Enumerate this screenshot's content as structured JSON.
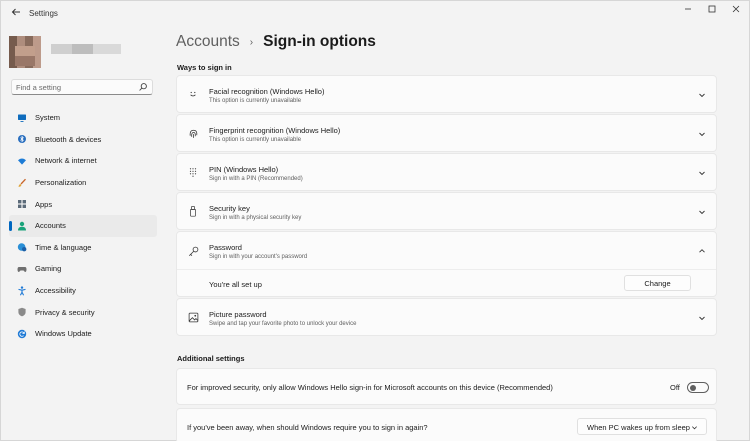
{
  "window": {
    "title": "Settings"
  },
  "search": {
    "placeholder": "Find a setting"
  },
  "sidebar": {
    "items": [
      {
        "label": "System",
        "icon": "monitor-icon",
        "color": "#0f6cbd",
        "active": false
      },
      {
        "label": "Bluetooth & devices",
        "icon": "bluetooth-icon",
        "color": "#2a6fbf",
        "active": false
      },
      {
        "label": "Network & internet",
        "icon": "wifi-icon",
        "color": "#1d7cd6",
        "active": false
      },
      {
        "label": "Personalization",
        "icon": "brush-icon",
        "color": "#c8642a",
        "active": false
      },
      {
        "label": "Apps",
        "icon": "apps-icon",
        "color": "#5c6b7a",
        "active": false
      },
      {
        "label": "Accounts",
        "icon": "person-icon",
        "color": "#1aa37a",
        "active": true
      },
      {
        "label": "Time & language",
        "icon": "globe-clock-icon",
        "color": "#2a8fd6",
        "active": false
      },
      {
        "label": "Gaming",
        "icon": "gamepad-icon",
        "color": "#707070",
        "active": false
      },
      {
        "label": "Accessibility",
        "icon": "accessibility-icon",
        "color": "#1f7ad6",
        "active": false
      },
      {
        "label": "Privacy & security",
        "icon": "shield-icon",
        "color": "#8a8a8a",
        "active": false
      },
      {
        "label": "Windows Update",
        "icon": "refresh-icon",
        "color": "#1f7ad6",
        "active": false
      }
    ]
  },
  "breadcrumb": {
    "parent": "Accounts",
    "separator": "›",
    "current": "Sign-in options"
  },
  "ways": {
    "heading": "Ways to sign in",
    "items": [
      {
        "title": "Facial recognition (Windows Hello)",
        "subtitle": "This option is currently unavailable",
        "icon": "smiley-face-icon"
      },
      {
        "title": "Fingerprint recognition (Windows Hello)",
        "subtitle": "This option is currently unavailable",
        "icon": "fingerprint-icon"
      },
      {
        "title": "PIN (Windows Hello)",
        "subtitle": "Sign in with a PIN (Recommended)",
        "icon": "keypad-icon"
      },
      {
        "title": "Security key",
        "subtitle": "Sign in with a physical security key",
        "icon": "usb-key-icon"
      },
      {
        "title": "Password",
        "subtitle": "Sign in with your account's password",
        "icon": "key-icon",
        "expanded": true,
        "status": "You're all set up",
        "action": "Change"
      },
      {
        "title": "Picture password",
        "subtitle": "Swipe and tap your favorite photo to unlock your device",
        "icon": "image-icon"
      }
    ]
  },
  "additional": {
    "heading": "Additional settings",
    "hello_only": {
      "label": "For improved security, only allow Windows Hello sign-in for Microsoft accounts on this device (Recommended)",
      "state": "Off"
    },
    "require_signin": {
      "label": "If you've been away, when should Windows require you to sign in again?",
      "value": "When PC wakes up from sleep"
    }
  }
}
